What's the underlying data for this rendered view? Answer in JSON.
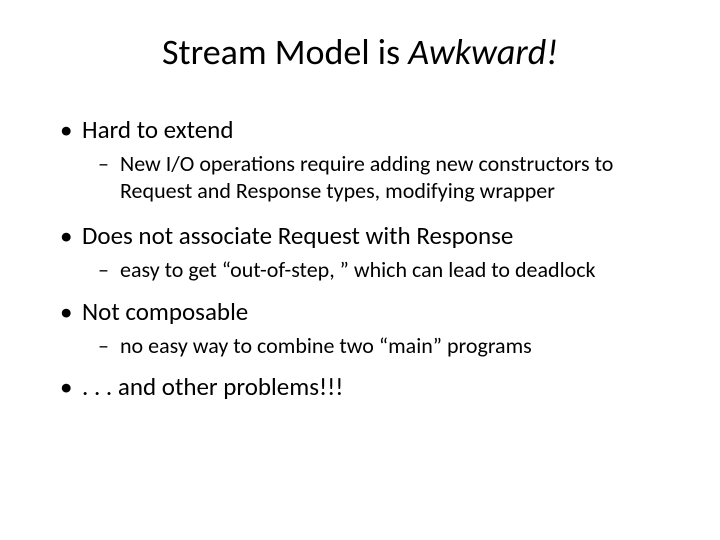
{
  "title": {
    "part1": "Stream Model is ",
    "part2": "Awkward!"
  },
  "bullets": {
    "b1": "Hard to extend",
    "b1a": "New I/O operations require adding new constructors to Request and Response types, modifying wrapper",
    "b2": "Does not associate Request with Response",
    "b2a": "easy to get “out-of-step, ” which can lead to deadlock",
    "b3": "Not composable",
    "b3a": "no easy way to combine two “main” programs",
    "b4": ". . . and other problems!!!"
  }
}
